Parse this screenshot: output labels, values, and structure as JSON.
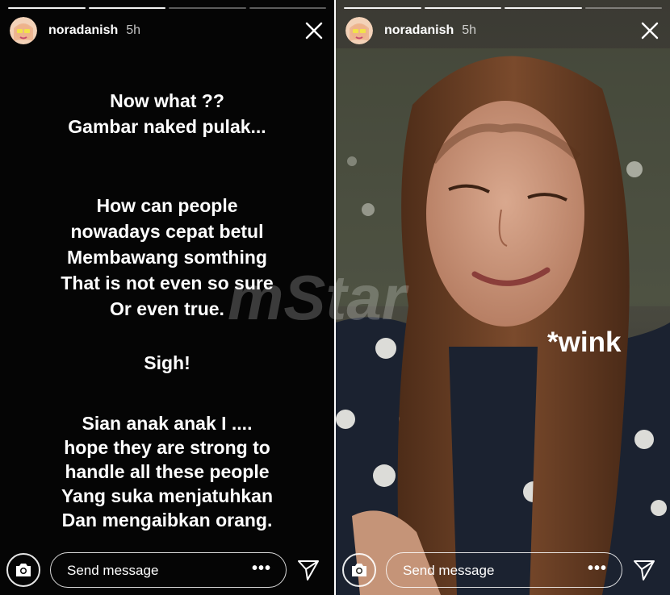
{
  "left_story": {
    "username": "noradanish",
    "time": "5h",
    "text_blocks": [
      [
        "Now what ??",
        "Gambar naked pulak..."
      ],
      [
        "How can people",
        "nowadays cepat betul",
        "Membawang somthing",
        "That is not even so sure",
        "Or even true."
      ],
      [
        "Sigh!"
      ],
      [
        "Sian anak anak I ....",
        "hope they are strong to",
        "handle all these people",
        "Yang suka menjatuhkan",
        "Dan mengaibkan orang."
      ]
    ],
    "message_placeholder": "Send message",
    "more_label": "•••"
  },
  "right_story": {
    "username": "noradanish",
    "time": "5h",
    "sticker_text": "*wink",
    "message_placeholder": "Send message",
    "more_label": "•••"
  },
  "watermark_text": "mStar",
  "colors": {
    "text": "#ffffff",
    "left_background": "#050505",
    "sweater": "#1b2230",
    "hair": "#6b3f24"
  },
  "icons": [
    "close-icon",
    "camera-icon",
    "more-icon",
    "send-icon"
  ]
}
